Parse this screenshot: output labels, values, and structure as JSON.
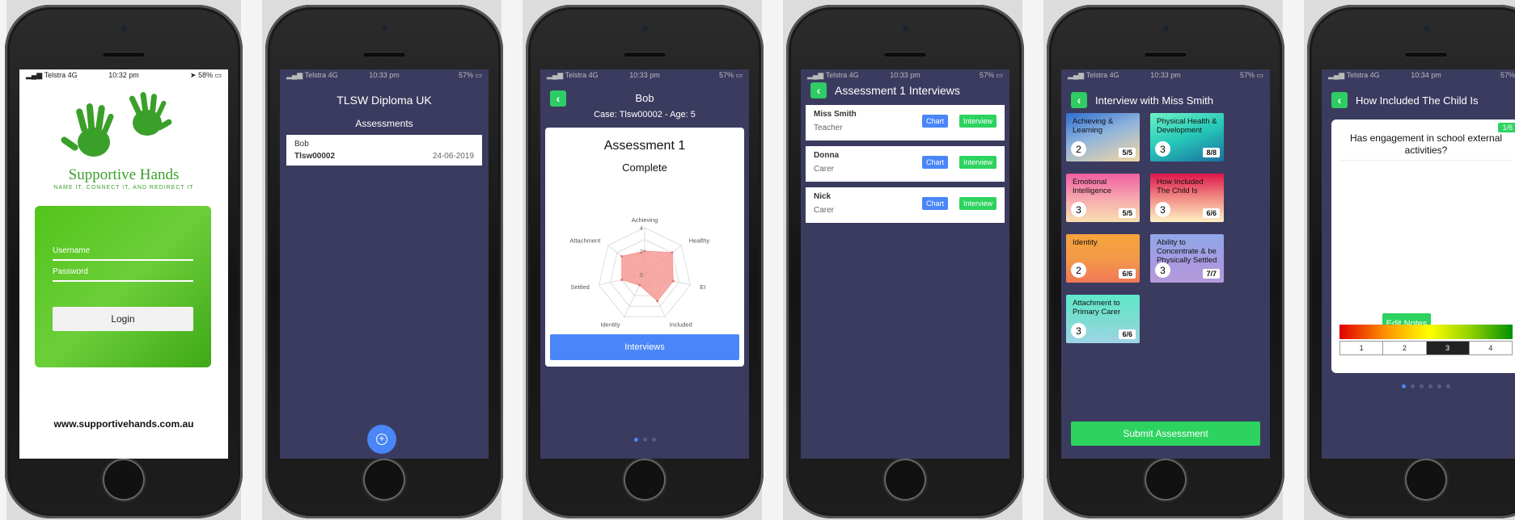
{
  "screen1": {
    "status": {
      "carrier": "Telstra",
      "network": "4G",
      "time": "10:32 pm",
      "battery": "58%"
    },
    "brand": "Supportive Hands",
    "tagline": "NAME IT, CONNECT IT, AND REDIRECT IT",
    "username_label": "Username",
    "password_label": "Password",
    "login_label": "Login",
    "website": "www.supportivehands.com.au"
  },
  "screen2": {
    "status": {
      "carrier": "Telstra",
      "network": "4G",
      "time": "10:33 pm",
      "battery": "57%"
    },
    "title": "TLSW Diploma UK",
    "subtitle": "Assessments",
    "item": {
      "name": "Bob",
      "id": "Tlsw00002",
      "date": "24-06-2019"
    },
    "fab_icon": "add-circle-icon"
  },
  "screen3": {
    "status": {
      "carrier": "Telstra",
      "network": "4G",
      "time": "10:33 pm",
      "battery": "57%"
    },
    "title": "Bob",
    "case_line": "Case: Tlsw00002 - Age: 5",
    "card_title": "Assessment 1",
    "card_status": "Complete",
    "interviews_label": "Interviews",
    "pager": {
      "count": 3,
      "active": 0
    },
    "chart_data": {
      "type": "radar",
      "axes": [
        "Achieving",
        "Healthy",
        "EI",
        "Included",
        "Identity",
        "Settled",
        "Attachment"
      ],
      "values": [
        2,
        3,
        2.5,
        2.5,
        1,
        2,
        2.5
      ],
      "ticks": [
        "0",
        "2",
        "4"
      ],
      "range": [
        0,
        4
      ],
      "fill_color": "#f49a95"
    }
  },
  "screen4": {
    "status": {
      "carrier": "Telstra",
      "network": "4G",
      "time": "10:33 pm",
      "battery": "57%"
    },
    "title": "Assessment 1 Interviews",
    "chart_label": "Chart",
    "interview_label": "Interview",
    "rows": [
      {
        "name": "Miss Smith",
        "role": "Teacher"
      },
      {
        "name": "Donna",
        "role": "Carer"
      },
      {
        "name": "Nick",
        "role": "Carer"
      }
    ]
  },
  "screen5": {
    "status": {
      "carrier": "Telstra",
      "network": "4G",
      "time": "10:33 pm",
      "battery": "57%"
    },
    "title": "Interview with Miss Smith",
    "cards": [
      {
        "title": "Achieving & Learning",
        "score": "2",
        "ratio": "5/5",
        "bg": "linear-gradient(160deg,#2f6fd0 0%,#8fb4dc 45%,#f5d8a0 100%)"
      },
      {
        "title": "Physical Health & Development",
        "score": "3",
        "ratio": "8/8",
        "bg": "linear-gradient(160deg,#6df2c5 0%,#25c7b8 50%,#1b6ea0 100%)"
      },
      {
        "title": "Emotional Intelligence",
        "score": "3",
        "ratio": "5/5",
        "bg": "linear-gradient(180deg,#f05fa3 0%,#f7b3b0 60%,#f7dfb0 100%)"
      },
      {
        "title": "How Included The Child Is",
        "score": "3",
        "ratio": "6/6",
        "bg": "linear-gradient(180deg,#e0154a 0%,#f08c84 50%,#fff1c4 100%)"
      },
      {
        "title": "Identity",
        "score": "2",
        "ratio": "6/6",
        "bg": "linear-gradient(180deg,#f7a43c 0%,#f29a48 50%,#f07858 100%)"
      },
      {
        "title": "Ability to Concentrate & be Physically Settled",
        "score": "3",
        "ratio": "7/7",
        "bg": "linear-gradient(180deg,#8fa8e8 0%,#a89ae0 60%,#b59ad8 100%)"
      },
      {
        "title": "Attachment to Primary Carer",
        "score": "3",
        "ratio": "6/6",
        "bg": "linear-gradient(180deg,#5fe8c9 0%,#7edcd2 55%,#9fd4e6 100%)"
      }
    ],
    "submit_label": "Submit Assessment"
  },
  "screen6": {
    "status": {
      "carrier": "Telstra",
      "network": "4G",
      "time": "10:34 pm",
      "battery": "57%"
    },
    "title": "How Included The Child Is",
    "badge": "1/6",
    "question": "Has engagement in school external activities?",
    "edit_notes_label": "Edit Notes",
    "scale": [
      "1",
      "2",
      "3",
      "4"
    ],
    "selected_index": 2,
    "pager": {
      "count": 6,
      "active": 0
    }
  },
  "colors": {
    "accent_green": "#2dd35f",
    "accent_blue": "#4a86f7",
    "dark_bg": "#3b3b60",
    "brand_green": "#3aa02a"
  }
}
